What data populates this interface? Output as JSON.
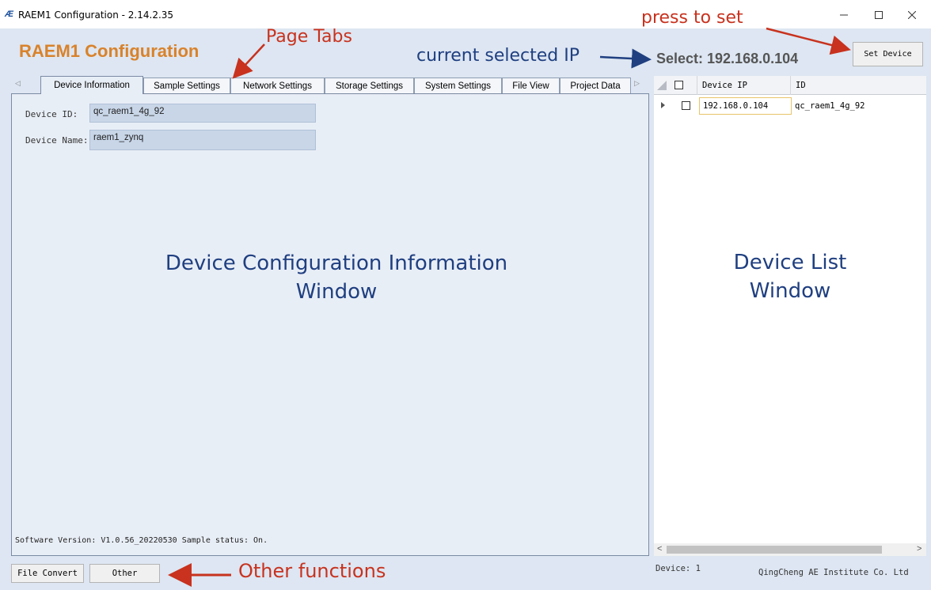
{
  "window": {
    "logo_text": "Æ",
    "title": "RAEM1 Configuration - 2.14.2.35",
    "controls": [
      "minimize-icon",
      "maximize-icon",
      "close-icon"
    ]
  },
  "header": {
    "app_heading": "RAEM1 Configuration",
    "select_label": "Select: 192.168.0.104",
    "set_device_label": "Set Device"
  },
  "tabs": [
    {
      "label": "Device Information",
      "active": true
    },
    {
      "label": "Sample Settings",
      "active": false
    },
    {
      "label": "Network Settings",
      "active": false
    },
    {
      "label": "Storage Settings",
      "active": false
    },
    {
      "label": "System Settings",
      "active": false
    },
    {
      "label": "File View",
      "active": false
    },
    {
      "label": "Project Data",
      "active": false
    }
  ],
  "tab_scroll": {
    "left": "◁",
    "right": "▷"
  },
  "device_info": {
    "id_label": "Device ID:",
    "id_value": "qc_raem1_4g_92",
    "name_label": "Device Name:",
    "name_value": "raem1_zynq",
    "software_status": "Software Version: V1.0.56_20220530  Sample status: On."
  },
  "overlays": {
    "config_window_line1": "Device Configuration Information",
    "config_window_line2": "Window",
    "device_list_line1": "Device List",
    "device_list_line2": "Window"
  },
  "device_list": {
    "columns": [
      "Device IP",
      "ID"
    ],
    "rows": [
      {
        "ip": "192.168.0.104",
        "id": "qc_raem1_4g_92",
        "checked": false
      }
    ],
    "scroll_left": "<",
    "scroll_right": ">"
  },
  "bottom": {
    "file_convert_label": "File Convert",
    "other_label": "Other",
    "device_count": "Device: 1",
    "company": "QingCheng AE Institute Co. Ltd"
  },
  "annotations": {
    "page_tabs": "Page Tabs",
    "press_to_set": "press to set",
    "current_selected_ip": "current selected IP",
    "other_functions": "Other functions"
  },
  "colors": {
    "heading_orange": "#d9822b",
    "annotation_red": "#c8321e",
    "annotation_blue": "#1f3f80",
    "field_bg": "#c8d6e8"
  }
}
